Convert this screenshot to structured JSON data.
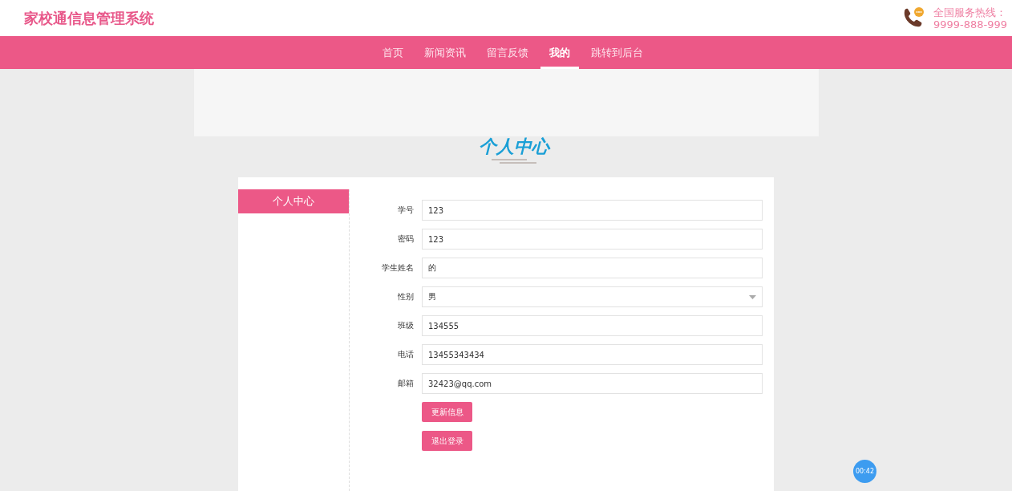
{
  "header": {
    "site_title": "家校通信息管理系统",
    "hotline_label": "全国服务热线：",
    "hotline_number": "9999-888-999"
  },
  "nav": [
    {
      "label": "首页",
      "selected": false
    },
    {
      "label": "新闻资讯",
      "selected": false
    },
    {
      "label": "留言反馈",
      "selected": false
    },
    {
      "label": "我的",
      "selected": true
    },
    {
      "label": "跳转到后台",
      "selected": false
    }
  ],
  "page_title": "个人中心",
  "sidebar": {
    "items": [
      {
        "label": "个人中心",
        "selected": true
      }
    ]
  },
  "form": {
    "fields": [
      {
        "label": "学号",
        "kind": "text",
        "value": "123"
      },
      {
        "label": "密码",
        "kind": "text",
        "value": "123"
      },
      {
        "label": "学生姓名",
        "kind": "text",
        "value": "的"
      },
      {
        "label": "性别",
        "kind": "select",
        "value": "男"
      },
      {
        "label": "班级",
        "kind": "text",
        "value": "134555"
      },
      {
        "label": "电话",
        "kind": "text",
        "value": "13455343434"
      },
      {
        "label": "邮箱",
        "kind": "text",
        "value": "32423@qq.com"
      }
    ],
    "buttons": [
      "更新信息",
      "退出登录"
    ]
  },
  "recorder": {
    "time": "00:42"
  }
}
